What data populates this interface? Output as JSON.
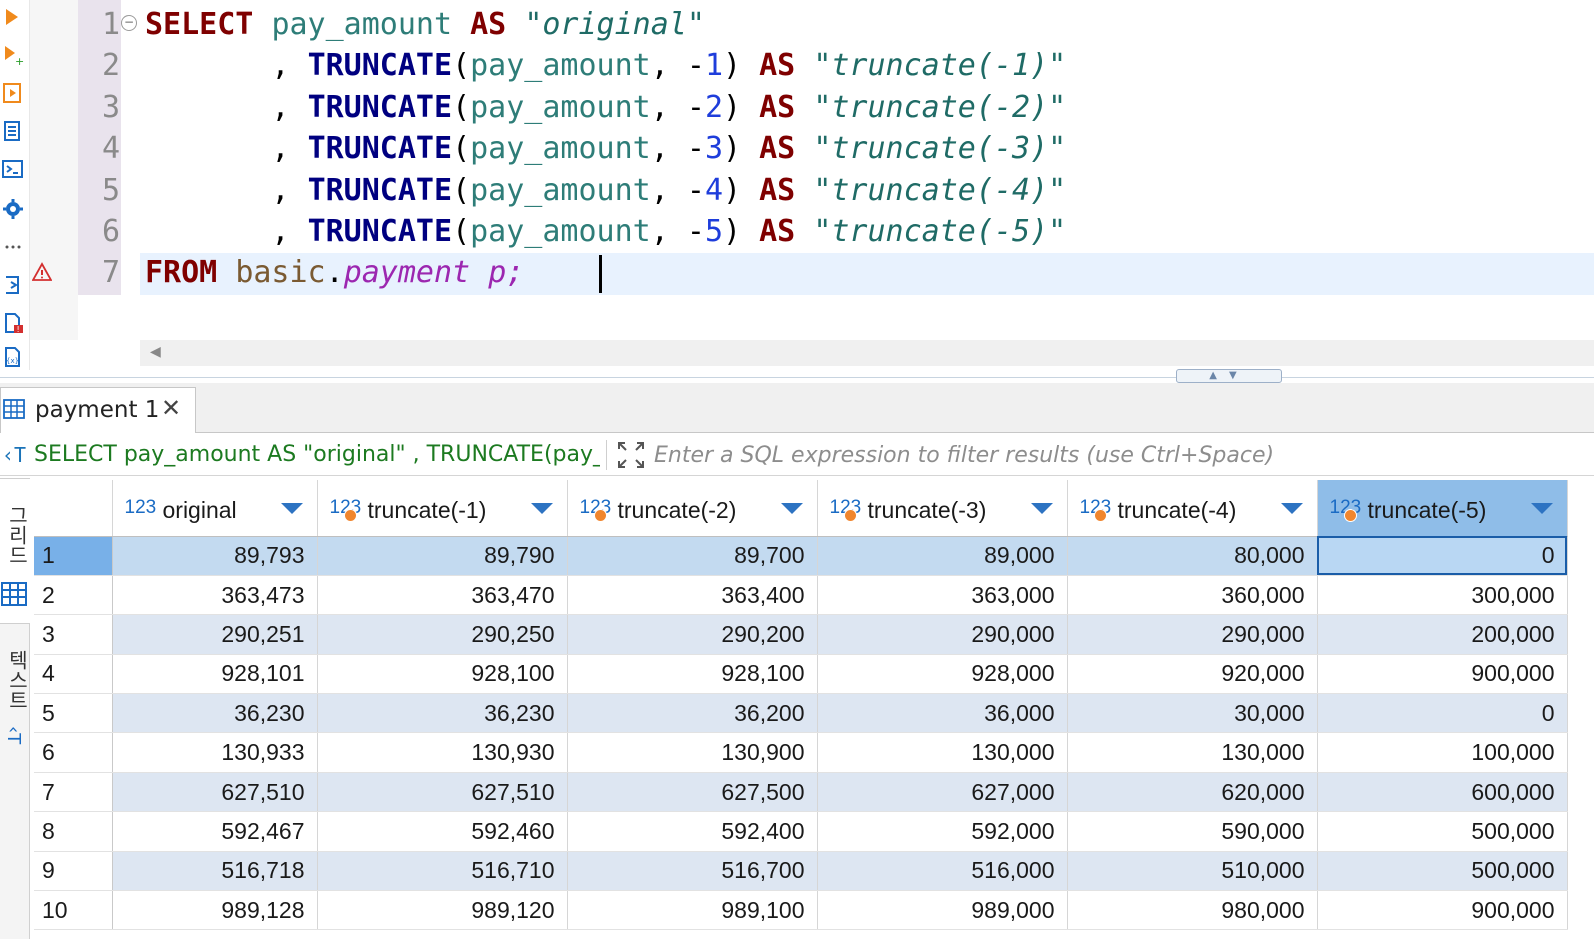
{
  "editor": {
    "line_numbers": [
      "1",
      "2",
      "3",
      "4",
      "5",
      "6",
      "7"
    ],
    "lines": [
      [
        {
          "t": "SELECT",
          "c": "kw"
        },
        {
          "t": " ",
          "c": "pun"
        },
        {
          "t": "pay_amount",
          "c": "col"
        },
        {
          "t": " ",
          "c": "pun"
        },
        {
          "t": "AS",
          "c": "kw"
        },
        {
          "t": " ",
          "c": "pun"
        },
        {
          "t": "\"original\"",
          "c": "str"
        }
      ],
      [
        {
          "t": "       , ",
          "c": "pun"
        },
        {
          "t": "TRUNCATE",
          "c": "fn"
        },
        {
          "t": "(",
          "c": "pun"
        },
        {
          "t": "pay_amount",
          "c": "col"
        },
        {
          "t": ", -",
          "c": "pun"
        },
        {
          "t": "1",
          "c": "num"
        },
        {
          "t": ") ",
          "c": "pun"
        },
        {
          "t": "AS",
          "c": "kw"
        },
        {
          "t": " ",
          "c": "pun"
        },
        {
          "t": "\"truncate(-1)\"",
          "c": "str"
        }
      ],
      [
        {
          "t": "       , ",
          "c": "pun"
        },
        {
          "t": "TRUNCATE",
          "c": "fn"
        },
        {
          "t": "(",
          "c": "pun"
        },
        {
          "t": "pay_amount",
          "c": "col"
        },
        {
          "t": ", -",
          "c": "pun"
        },
        {
          "t": "2",
          "c": "num"
        },
        {
          "t": ") ",
          "c": "pun"
        },
        {
          "t": "AS",
          "c": "kw"
        },
        {
          "t": " ",
          "c": "pun"
        },
        {
          "t": "\"truncate(-2)\"",
          "c": "str"
        }
      ],
      [
        {
          "t": "       , ",
          "c": "pun"
        },
        {
          "t": "TRUNCATE",
          "c": "fn"
        },
        {
          "t": "(",
          "c": "pun"
        },
        {
          "t": "pay_amount",
          "c": "col"
        },
        {
          "t": ", -",
          "c": "pun"
        },
        {
          "t": "3",
          "c": "num"
        },
        {
          "t": ") ",
          "c": "pun"
        },
        {
          "t": "AS",
          "c": "kw"
        },
        {
          "t": " ",
          "c": "pun"
        },
        {
          "t": "\"truncate(-3)\"",
          "c": "str"
        }
      ],
      [
        {
          "t": "       , ",
          "c": "pun"
        },
        {
          "t": "TRUNCATE",
          "c": "fn"
        },
        {
          "t": "(",
          "c": "pun"
        },
        {
          "t": "pay_amount",
          "c": "col"
        },
        {
          "t": ", -",
          "c": "pun"
        },
        {
          "t": "4",
          "c": "num"
        },
        {
          "t": ") ",
          "c": "pun"
        },
        {
          "t": "AS",
          "c": "kw"
        },
        {
          "t": " ",
          "c": "pun"
        },
        {
          "t": "\"truncate(-4)\"",
          "c": "str"
        }
      ],
      [
        {
          "t": "       , ",
          "c": "pun"
        },
        {
          "t": "TRUNCATE",
          "c": "fn"
        },
        {
          "t": "(",
          "c": "pun"
        },
        {
          "t": "pay_amount",
          "c": "col"
        },
        {
          "t": ", -",
          "c": "pun"
        },
        {
          "t": "5",
          "c": "num"
        },
        {
          "t": ") ",
          "c": "pun"
        },
        {
          "t": "AS",
          "c": "kw"
        },
        {
          "t": " ",
          "c": "pun"
        },
        {
          "t": "\"truncate(-5)\"",
          "c": "str"
        }
      ],
      [
        {
          "t": "FROM",
          "c": "kw"
        },
        {
          "t": " ",
          "c": "pun"
        },
        {
          "t": "basic",
          "c": "tbl"
        },
        {
          "t": ".",
          "c": "pun"
        },
        {
          "t": "payment",
          "c": "alias"
        },
        {
          "t": " ",
          "c": "pun"
        },
        {
          "t": "p;",
          "c": "alias"
        }
      ]
    ]
  },
  "results": {
    "tab_label": "payment 1",
    "sql_preview": "SELECT pay_amount AS \"original\" , TRUNCATE(pay_ar",
    "filter_placeholder": "Enter a SQL expression to filter results (use Ctrl+Space)",
    "side_tabs": [
      "그리드",
      "텍스트"
    ],
    "type_badge": "123",
    "columns": [
      "original",
      "truncate(-1)",
      "truncate(-2)",
      "truncate(-3)",
      "truncate(-4)",
      "truncate(-5)"
    ],
    "rows": [
      {
        "n": "1",
        "cells": [
          "89,793",
          "89,790",
          "89,700",
          "89,000",
          "80,000",
          "0"
        ]
      },
      {
        "n": "2",
        "cells": [
          "363,473",
          "363,470",
          "363,400",
          "363,000",
          "360,000",
          "300,000"
        ]
      },
      {
        "n": "3",
        "cells": [
          "290,251",
          "290,250",
          "290,200",
          "290,000",
          "290,000",
          "200,000"
        ]
      },
      {
        "n": "4",
        "cells": [
          "928,101",
          "928,100",
          "928,100",
          "928,000",
          "920,000",
          "900,000"
        ]
      },
      {
        "n": "5",
        "cells": [
          "36,230",
          "36,230",
          "36,200",
          "36,000",
          "30,000",
          "0"
        ]
      },
      {
        "n": "6",
        "cells": [
          "130,933",
          "130,930",
          "130,900",
          "130,000",
          "130,000",
          "100,000"
        ]
      },
      {
        "n": "7",
        "cells": [
          "627,510",
          "627,510",
          "627,500",
          "627,000",
          "620,000",
          "600,000"
        ]
      },
      {
        "n": "8",
        "cells": [
          "592,467",
          "592,460",
          "592,400",
          "592,000",
          "590,000",
          "500,000"
        ]
      },
      {
        "n": "9",
        "cells": [
          "516,718",
          "516,710",
          "516,700",
          "516,000",
          "510,000",
          "500,000"
        ]
      },
      {
        "n": "10",
        "cells": [
          "989,128",
          "989,120",
          "989,100",
          "989,000",
          "980,000",
          "900,000"
        ]
      }
    ]
  },
  "colors": {
    "keyword": "#7f0000",
    "function": "#000080",
    "selection": "#78b0e8",
    "row_alt": "#dde6f2"
  }
}
